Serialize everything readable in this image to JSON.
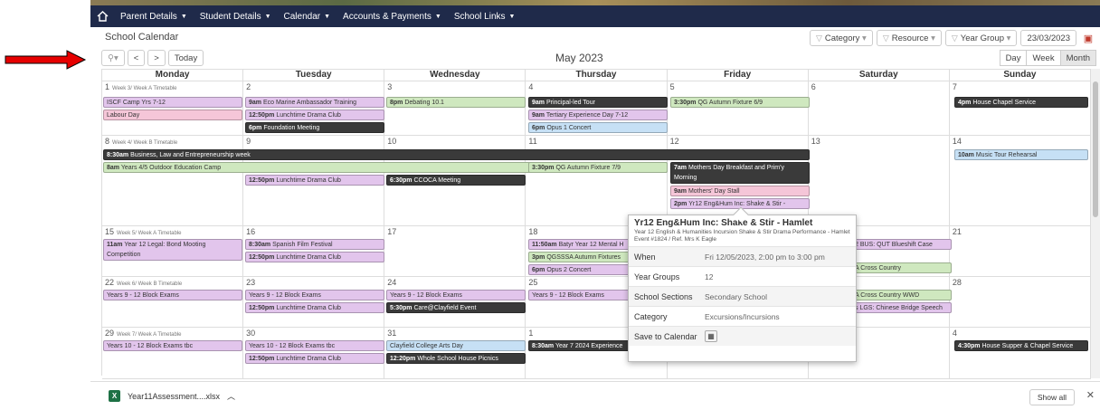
{
  "nav": {
    "items": [
      "Parent Details",
      "Student Details",
      "Calendar",
      "Accounts & Payments",
      "School Links"
    ]
  },
  "page_title": "School Calendar",
  "filters": {
    "category": "Category",
    "resource": "Resource",
    "year_group": "Year Group",
    "date": "23/03/2023"
  },
  "toolbar": {
    "today": "Today",
    "prev": "<",
    "next": ">",
    "zoom": "⚲▾"
  },
  "month_title": "May 2023",
  "views": [
    "Day",
    "Week",
    "Month"
  ],
  "days": [
    "Monday",
    "Tuesday",
    "Wednesday",
    "Thursday",
    "Friday",
    "Saturday",
    "Sunday"
  ],
  "weeks": [
    {
      "label": "Week 3/ Week A Timetable",
      "dates": [
        "1",
        "2",
        "3",
        "4",
        "5",
        "6",
        "7"
      ]
    },
    {
      "label": "Week 4/ Week B Timetable",
      "dates": [
        "8",
        "9",
        "10",
        "11",
        "12",
        "13",
        "14"
      ]
    },
    {
      "label": "Week 5/ Week A Timetable",
      "dates": [
        "15",
        "16",
        "17",
        "18",
        "19",
        "20",
        "21"
      ]
    },
    {
      "label": "Week 6/ Week B Timetable",
      "dates": [
        "22",
        "23",
        "24",
        "25",
        "26",
        "27",
        "28"
      ]
    },
    {
      "label": "Week 7/ Week A Timetable",
      "dates": [
        "29",
        "30",
        "31",
        "1",
        "2",
        "3",
        "4"
      ]
    }
  ],
  "events": {
    "w1": [
      "ISCF Camp Yrs 7-12",
      "Labour Day",
      "9am Eco Marine Ambassador Training",
      "12:50pm Lunchtime Drama Club",
      "6pm Foundation Meeting",
      "8pm Debating 10.1",
      "9am Principal-led Tour",
      "9am Tertiary Experience Day 7-12",
      "6pm Opus 1 Concert",
      "3:30pm QG Autumn Fixture 6/9",
      "4pm House Chapel Service"
    ],
    "w2": [
      "8:30am Business, Law and Entrepreneurship week",
      "8am Years 4/5 Outdoor Education Camp",
      "12:50pm Lunchtime Drama Club",
      "6:30pm CCOCA Meeting",
      "3:30pm QG Autumn Fixture 7/9",
      "7am Mothers Day Breakfast and Prim'y Morning",
      "9am Mothers' Day Stall",
      "2pm Yr12 Eng&Hum Inc: Shake & Stir -",
      "10am Music Tour Rehearsal"
    ],
    "w3": [
      "11am Year 12 Legal: Bond Mooting Competition",
      "8:30am Spanish Film Festival",
      "12:50pm Lunchtime Drama Club",
      "11:50am Batyr Year 12 Mental H",
      "3pm QGSSSA Autumn Fixtures",
      "6pm Opus 2 Concert",
      "2 BUS: QUT Blueshift Case",
      "A Cross Country"
    ],
    "w4": [
      "Years 9 - 12 Block Exams",
      "Years 9 - 12 Block Exams",
      "12:50pm Lunchtime Drama Club",
      "Years 9 - 12 Block Exams",
      "5:30pm Care@Clayfield Event",
      "Years 9 - 12 Block Exams",
      "A Cross Country WWD",
      "s LGS: Chinese Bridge Speech"
    ],
    "w5": [
      "Years 10 - 12 Block Exams tbc",
      "Years 10 - 12 Block Exams tbc",
      "12:50pm Lunchtime Drama Club",
      "Clayfield College Arts Day",
      "12:20pm Whole School House Picnics",
      "8:30am Year 7 2024 Experience",
      "4:30pm House Supper & Chapel Service"
    ]
  },
  "popup": {
    "title": "Yr12 Eng&Hum Inc: Shake & Stir - Hamlet",
    "desc": "Year 12 English & Humanities Incursion Shake & Stir Drama Performance - Hamlet Event #1824 / Ref. Mrs K Eagle",
    "when_label": "When",
    "when": "Fri 12/05/2023, 2:00 pm to 3:00 pm",
    "yg_label": "Year Groups",
    "yg": "12",
    "ss_label": "School Sections",
    "ss": "Secondary School",
    "cat_label": "Category",
    "cat": "Excursions/Incursions",
    "save_label": "Save to Calendar"
  },
  "download": {
    "file": "Year11Assessment....xlsx",
    "show_all": "Show all"
  }
}
